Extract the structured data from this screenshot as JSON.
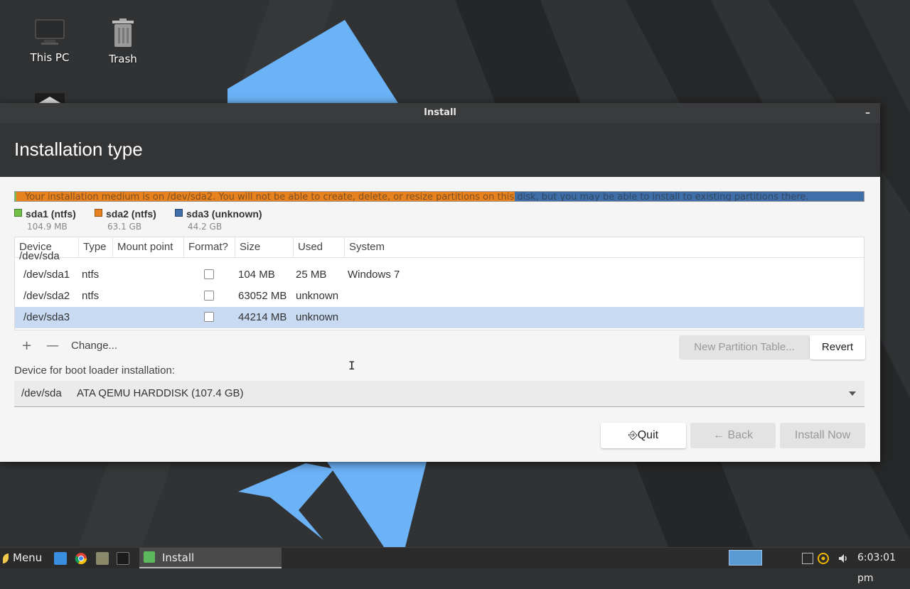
{
  "desktop": {
    "icons": [
      {
        "label": "This PC",
        "icon": "computer-icon"
      },
      {
        "label": "Trash",
        "icon": "trash-icon"
      }
    ]
  },
  "window": {
    "title": "Install",
    "minimize_glyph": "–",
    "page_title": "Installation type"
  },
  "partition_bar": {
    "overlay_text": "Your installation medium is on /dev/sda2. You will not be able to create, delete, or resize partitions on this disk, but you may be able to install to existing partitions there.",
    "segments": [
      {
        "name": "sda1 (ntfs)",
        "size": "104.9 MB",
        "color": "#73c147",
        "fraction": 0.001
      },
      {
        "name": "sda2 (ntfs)",
        "size": "63.1 GB",
        "color": "#e8821e",
        "fraction": 0.587
      },
      {
        "name": "sda3 (unknown)",
        "size": "44.2 GB",
        "color": "#3f6ea8",
        "fraction": 0.412
      }
    ]
  },
  "partition_table": {
    "headers": [
      "Device",
      "Type",
      "Mount point",
      "Format?",
      "Size",
      "Used",
      "System"
    ],
    "disk": "/dev/sda",
    "rows": [
      {
        "device": "/dev/sda1",
        "type": "ntfs",
        "mount": "",
        "size": "104 MB",
        "used": "25 MB",
        "system": "Windows 7",
        "selected": false
      },
      {
        "device": "/dev/sda2",
        "type": "ntfs",
        "mount": "",
        "size": "63052 MB",
        "used": "unknown",
        "system": "",
        "selected": false
      },
      {
        "device": "/dev/sda3",
        "type": "",
        "mount": "",
        "size": "44214 MB",
        "used": "unknown",
        "system": "",
        "selected": true
      }
    ]
  },
  "table_tools": {
    "add": "+",
    "remove": "—",
    "change": "Change...",
    "new_partition_table": "New Partition Table...",
    "revert": "Revert"
  },
  "bootloader": {
    "label": "Device for boot loader installation:",
    "device": "/dev/sda",
    "description": "ATA QEMU HARDDISK (107.4 GB)"
  },
  "footer": {
    "quit": "Quit",
    "quit_icon": "⎆",
    "back": "Back",
    "back_icon": "←",
    "install_now": "Install Now"
  },
  "taskbar": {
    "menu_label": "Menu",
    "active_task": "Install",
    "clock": "6:03:01 pm",
    "quick_launch": [
      "file-manager-icon",
      "chrome-icon",
      "files-icon",
      "terminal-icon"
    ],
    "tray": [
      "display-icon",
      "update-icon",
      "volume-icon"
    ]
  },
  "colors": {
    "accent": "#c8dbf2",
    "header_bg": "#333435",
    "taskbar_bg": "#2b2b2b",
    "desktop_blue": "#6cb2f7"
  }
}
